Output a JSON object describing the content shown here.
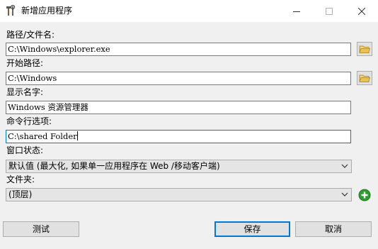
{
  "window": {
    "title": "新增应用程序",
    "minimize_icon": "minimize-icon",
    "maximize_icon": "maximize-icon",
    "close_icon": "close-icon"
  },
  "form": {
    "path": {
      "label": "路径/文件名:",
      "value": "C:\\Windows\\explorer.exe",
      "browse_icon": "folder-icon"
    },
    "start_path": {
      "label": "开始路径:",
      "value": "C:\\Windows",
      "browse_icon": "folder-icon"
    },
    "display_name": {
      "label": "显示名字:",
      "value": "Windows 资源管理器"
    },
    "cmd_options": {
      "label": "命令行选项:",
      "value": "C:\\shared Folder"
    },
    "window_state": {
      "label": "窗口状态:",
      "selected": "默认值 (最大化, 如果单一应用程序在 Web /移动客户端)"
    },
    "folder": {
      "label": "文件夹:",
      "selected": "(顶层)",
      "add_icon": "add-icon"
    }
  },
  "buttons": {
    "test": "测试",
    "save": "保存",
    "cancel": "取消"
  },
  "colors": {
    "focus": "#0078d7",
    "add_green": "#2e9e2e",
    "folder_yellow": "#e8c35a"
  }
}
